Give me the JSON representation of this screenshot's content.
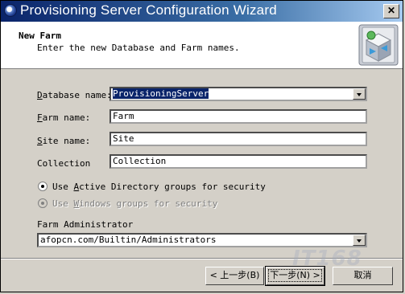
{
  "window": {
    "title": "Provisioning Server Configuration Wizard",
    "close_glyph": "✕"
  },
  "header": {
    "heading": "New Farm",
    "subheading": "Enter the new Database and Farm names."
  },
  "form": {
    "database_name": {
      "label_prefix": "D",
      "label_rest": "atabase name:",
      "value": "ProvisioningServer"
    },
    "farm_name": {
      "label_prefix": "F",
      "label_rest": "arm name:",
      "value": "Farm"
    },
    "site_name": {
      "label_prefix": "S",
      "label_rest": "ite name:",
      "value": "Site"
    },
    "collection": {
      "label": "Collection",
      "value": "Collection"
    },
    "radio_ad": {
      "pre": "Use ",
      "accel": "A",
      "post": "ctive Directory groups for security",
      "checked": true
    },
    "radio_win": {
      "pre": "Use ",
      "accel": "W",
      "post": "indows groups for security",
      "checked": true,
      "disabled": true
    },
    "farm_admin": {
      "label": "Farm Administrator",
      "value": "afopcn.com/Builtin/Administrators"
    }
  },
  "buttons": {
    "back": "< 上一步(B)",
    "next": "下一步(N) >",
    "cancel": "取消"
  },
  "watermark": "IT168",
  "colors": {
    "title_gradient_start": "#0a246a",
    "title_gradient_end": "#a6caf0",
    "dialog_bg": "#d4d0c8",
    "selection": "#0a246a"
  }
}
